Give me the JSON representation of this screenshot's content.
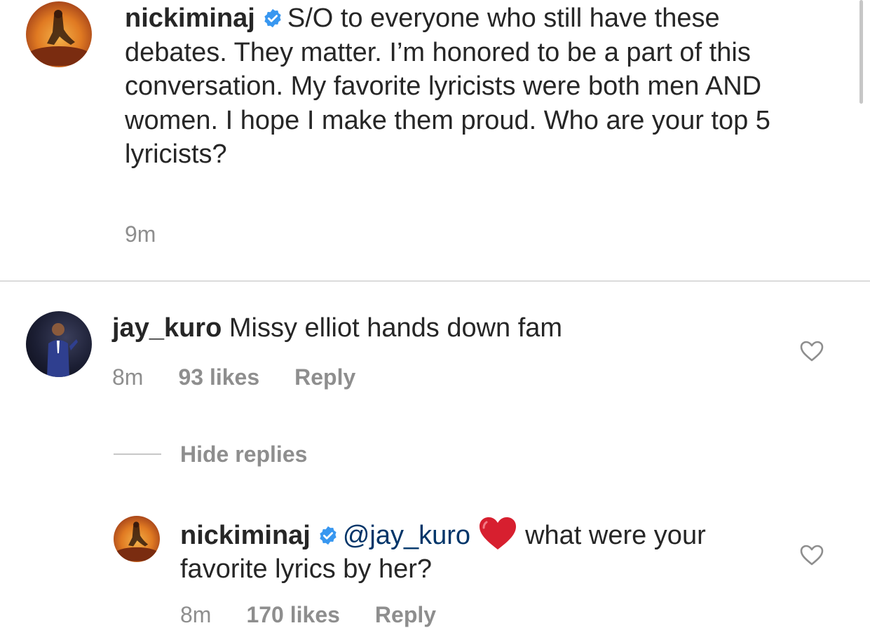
{
  "post": {
    "username": "nickiminaj",
    "caption": "S/O to everyone who still have these debates. They matter. I’m honored to be a part of this conversation. My favorite lyricists were both men AND women. I hope I make them proud. Who are your top 5 lyricists?",
    "time": "9m"
  },
  "comments": [
    {
      "username": "jay_kuro",
      "text": "Missy elliot hands down fam",
      "time": "8m",
      "likes": "93 likes",
      "reply": "Reply"
    }
  ],
  "hide_replies": "Hide replies",
  "reply": {
    "username": "nickiminaj",
    "mention": "@jay_kuro",
    "text": "what were your favorite lyrics by her?",
    "time": "8m",
    "likes": "170 likes",
    "reply": "Reply"
  },
  "colors": {
    "text": "#262626",
    "muted": "#8e8e8e",
    "verified": "#3897f0",
    "mention": "#003569",
    "heart_red": "#d71f2f"
  },
  "icons": [
    "verified-badge-icon",
    "heart-outline-icon",
    "red-heart-emoji"
  ]
}
